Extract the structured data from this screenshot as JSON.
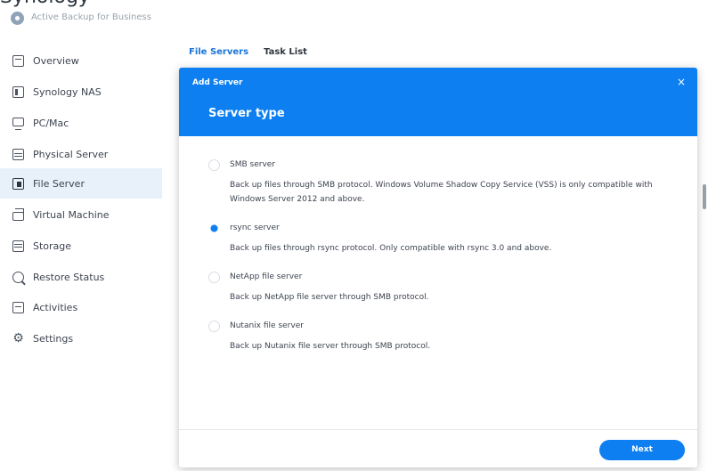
{
  "cut_text": "Synology",
  "app": {
    "title": "Active Backup for Business"
  },
  "sidebar": {
    "items": [
      {
        "label": "Overview",
        "icon": "overview-icon"
      },
      {
        "label": "Synology NAS",
        "icon": "nas-icon"
      },
      {
        "label": "PC/Mac",
        "icon": "pc-icon"
      },
      {
        "label": "Physical Server",
        "icon": "server-icon"
      },
      {
        "label": "File Server",
        "icon": "file-server-icon",
        "active": true
      },
      {
        "label": "Virtual Machine",
        "icon": "virtual-machine-icon"
      },
      {
        "label": "Storage",
        "icon": "storage-icon"
      },
      {
        "label": "Restore Status",
        "icon": "restore-icon"
      },
      {
        "label": "Activities",
        "icon": "activities-icon"
      },
      {
        "label": "Settings",
        "icon": "gear-icon"
      }
    ]
  },
  "tabs": [
    {
      "label": "File Servers",
      "active": true
    },
    {
      "label": "Task List",
      "active": false
    }
  ],
  "dialog": {
    "title": "Add Server",
    "close": "×",
    "subtitle": "Server type",
    "options": [
      {
        "label": "SMB server",
        "description": "Back up files through SMB protocol. Windows Volume Shadow Copy Service (VSS) is only compatible with Windows Server 2012 and above.",
        "selected": false
      },
      {
        "label": "rsync server",
        "description": "Back up files through rsync protocol. Only compatible with rsync 3.0 and above.",
        "selected": true
      },
      {
        "label": "NetApp file server",
        "description": "Back up NetApp file server through SMB protocol.",
        "selected": false
      },
      {
        "label": "Nutanix file server",
        "description": "Back up Nutanix file server through SMB protocol.",
        "selected": false
      }
    ],
    "next_label": "Next"
  },
  "colors": {
    "accent": "#0d7ff0",
    "active_nav_bg": "#e8f0fa"
  }
}
